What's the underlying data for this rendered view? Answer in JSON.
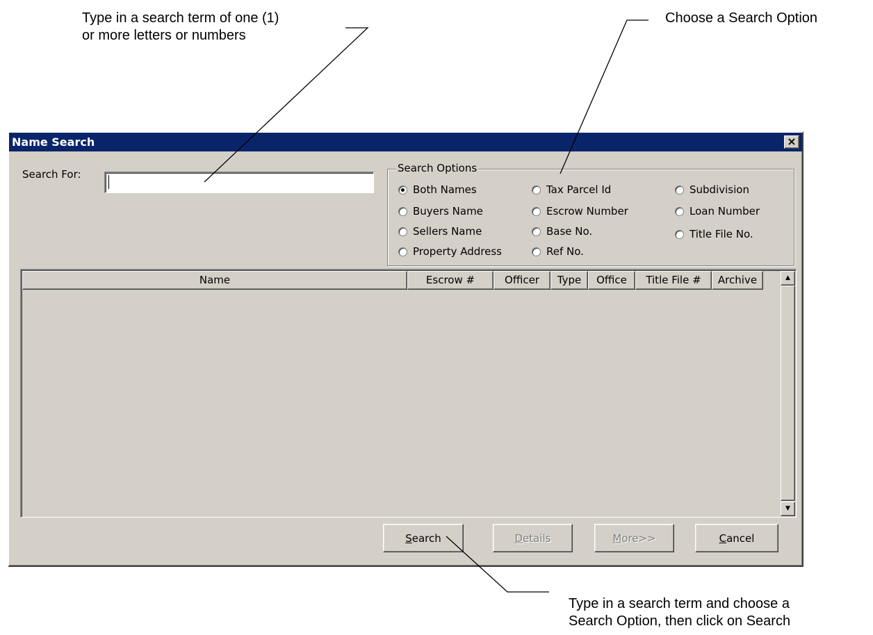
{
  "annotations": {
    "search_term": {
      "line1": "Type in a search term of one (1)",
      "line2": "or more letters or numbers"
    },
    "choose_option": "Choose a Search Option",
    "click_search": {
      "line1": "Type in a search term and choose a",
      "line2": "Search Option, then click on Search"
    }
  },
  "dialog": {
    "title": "Name Search",
    "close_glyph": "×",
    "search_for_label": "Search For:",
    "search_input": {
      "value": "",
      "placeholder": ""
    },
    "search_options": {
      "legend": "Search Options",
      "selected": "Both Names",
      "options": {
        "both_names": "Both Names",
        "buyers_name": "Buyers Name",
        "sellers_name": "Sellers Name",
        "property_address": "Property Address",
        "tax_parcel_id": "Tax Parcel Id",
        "escrow_number": "Escrow Number",
        "base_no": "Base No.",
        "ref_no": "Ref No.",
        "subdivision": "Subdivision",
        "loan_number": "Loan Number",
        "title_file_no": "Title File No."
      }
    },
    "results": {
      "columns": {
        "name": "Name",
        "escrow": "Escrow #",
        "officer": "Officer",
        "type": "Type",
        "office": "Office",
        "title_file": "Title File #",
        "archive": "Archive"
      },
      "rows": []
    },
    "buttons": {
      "search": {
        "mnemonic": "S",
        "rest": "earch",
        "enabled": true
      },
      "details": {
        "mnemonic": "D",
        "rest": "etails",
        "enabled": false
      },
      "more": {
        "mnemonic": "M",
        "rest": "ore>>",
        "enabled": false
      },
      "cancel": {
        "mnemonic": "C",
        "rest": "ancel",
        "enabled": true
      }
    }
  },
  "icons": {
    "close": "close-icon",
    "scroll_up": "scroll-up-arrow-icon",
    "scroll_down": "scroll-down-arrow-icon"
  },
  "colors": {
    "titlebar": "#0a246a",
    "dialog_face": "#d4d0c8",
    "disabled_text": "#808080"
  }
}
